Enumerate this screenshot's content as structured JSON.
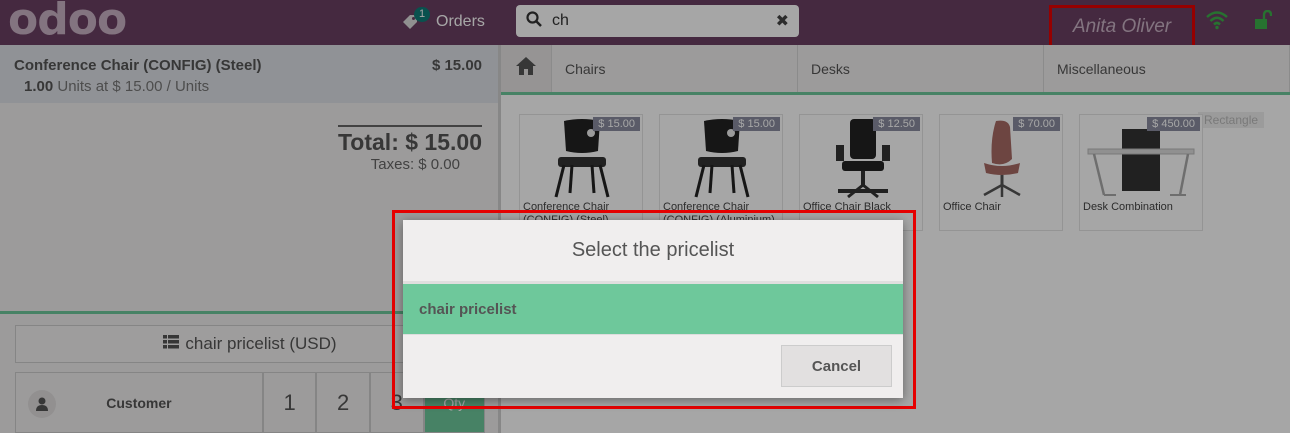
{
  "header": {
    "logo_text": "odoo",
    "orders_badge": "1",
    "orders_label": "Orders",
    "search_value": "ch",
    "search_clear": "✖",
    "user_name": "Anita Oliver"
  },
  "order": {
    "line_name": "Conference Chair (CONFIG) (Steel)",
    "line_price": "$ 15.00",
    "line_qty": "1.00",
    "line_detail": "Units at $ 15.00 / Units",
    "total": "Total: $ 15.00",
    "taxes": "Taxes: $ 0.00"
  },
  "controls": {
    "pricelist_button": "chair pricelist (USD)",
    "customer_label": "Customer",
    "num1": "1",
    "num2": "2",
    "num3": "3",
    "qty_label": "Qty"
  },
  "categories": [
    "Chairs",
    "Desks",
    "Miscellaneous"
  ],
  "products": [
    {
      "name": "Conference Chair (CONFIG) (Steel)",
      "price": "$ 15.00"
    },
    {
      "name": "Conference Chair (CONFIG) (Aluminium)",
      "price": "$ 15.00"
    },
    {
      "name": "Office Chair Black",
      "price": "$ 12.50"
    },
    {
      "name": "Office Chair",
      "price": "$ 70.00"
    },
    {
      "name": "Desk Combination",
      "price": "$ 450.00"
    }
  ],
  "rect_label": "Rectangle",
  "modal": {
    "title": "Select the pricelist",
    "option": "chair pricelist",
    "cancel": "Cancel"
  },
  "colors": {
    "topbar": "#6b3f63",
    "accent_green": "#6ec89b",
    "highlight_red": "#e60000",
    "badge": "#0f7d78"
  }
}
